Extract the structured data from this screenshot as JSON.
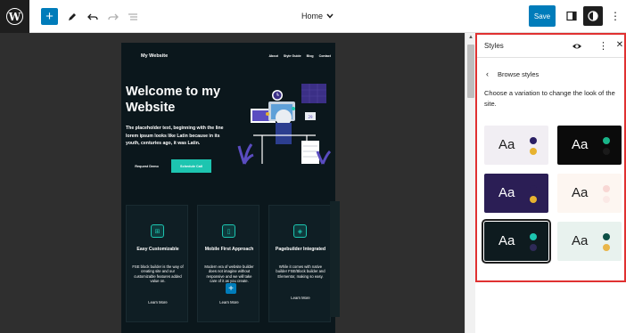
{
  "toolbar": {
    "logo_letter": "W",
    "add_symbol": "+",
    "document_title": "Home",
    "save_label": "Save",
    "more_symbol": "⋮"
  },
  "site": {
    "title": "My Website",
    "nav": [
      "About",
      "Style Guide",
      "Blog",
      "Contact"
    ],
    "hero_heading": "Welcome to my Website",
    "hero_text": "The placeholder text, beginning with the line lorem ipsum looks like Latin because in its youth, centuries ago, it was Latin.",
    "request_demo": "Request Demo",
    "schedule_call": "Schedule Call",
    "features": [
      {
        "title": "Easy Customizable",
        "desc": "FSE block builder is the way of creating site and our customizable features added value on.",
        "more": "Learn More"
      },
      {
        "title": "Mobile First Approach",
        "desc": "Modern era of website builder does not imagine without responsive and we will take care of it as you create.",
        "more": "Learn More"
      },
      {
        "title": "Pagebuilder Integrated",
        "desc": "While it comes with native builder FSE/Block builder and Elementor, making so easy.",
        "more": "Learn More"
      }
    ],
    "add_symbol": "+"
  },
  "panel": {
    "title": "Styles",
    "more_symbol": "⋮",
    "close_symbol": "✕",
    "back_chevron": "‹",
    "back_label": "Browse styles",
    "description": "Choose a variation to change the look of the site.",
    "variations": [
      {
        "label": "Aa",
        "bg": "#f1eef3",
        "text": "#1e1e1e",
        "dot1": "#2a1f64",
        "dot2": "#e7b22f"
      },
      {
        "label": "Aa",
        "bg": "#0b0b0b",
        "text": "#ffffff",
        "dot1": "#19b589",
        "dot2": "#1a1a1a"
      },
      {
        "label": "Aa",
        "bg": "#2b1e55",
        "text": "#ffffff",
        "dot1": "#2b1e55",
        "dot2": "#e7b22f"
      },
      {
        "label": "Aa",
        "bg": "#fdf6f1",
        "text": "#1e1e1e",
        "dot1": "#f8d7d4",
        "dot2": "#fbe9e6"
      },
      {
        "label": "Aa",
        "bg": "#0e1b1f",
        "text": "#ffffff",
        "dot1": "#1dc5b0",
        "dot2": "#2e2a57"
      },
      {
        "label": "Aa",
        "bg": "#e8f2ee",
        "text": "#1e1e1e",
        "dot1": "#0d5046",
        "dot2": "#e9b64a"
      }
    ]
  },
  "colors": {
    "accent": "#007cba",
    "highlight_border": "#e03131",
    "site_teal": "#1dc5b0"
  }
}
